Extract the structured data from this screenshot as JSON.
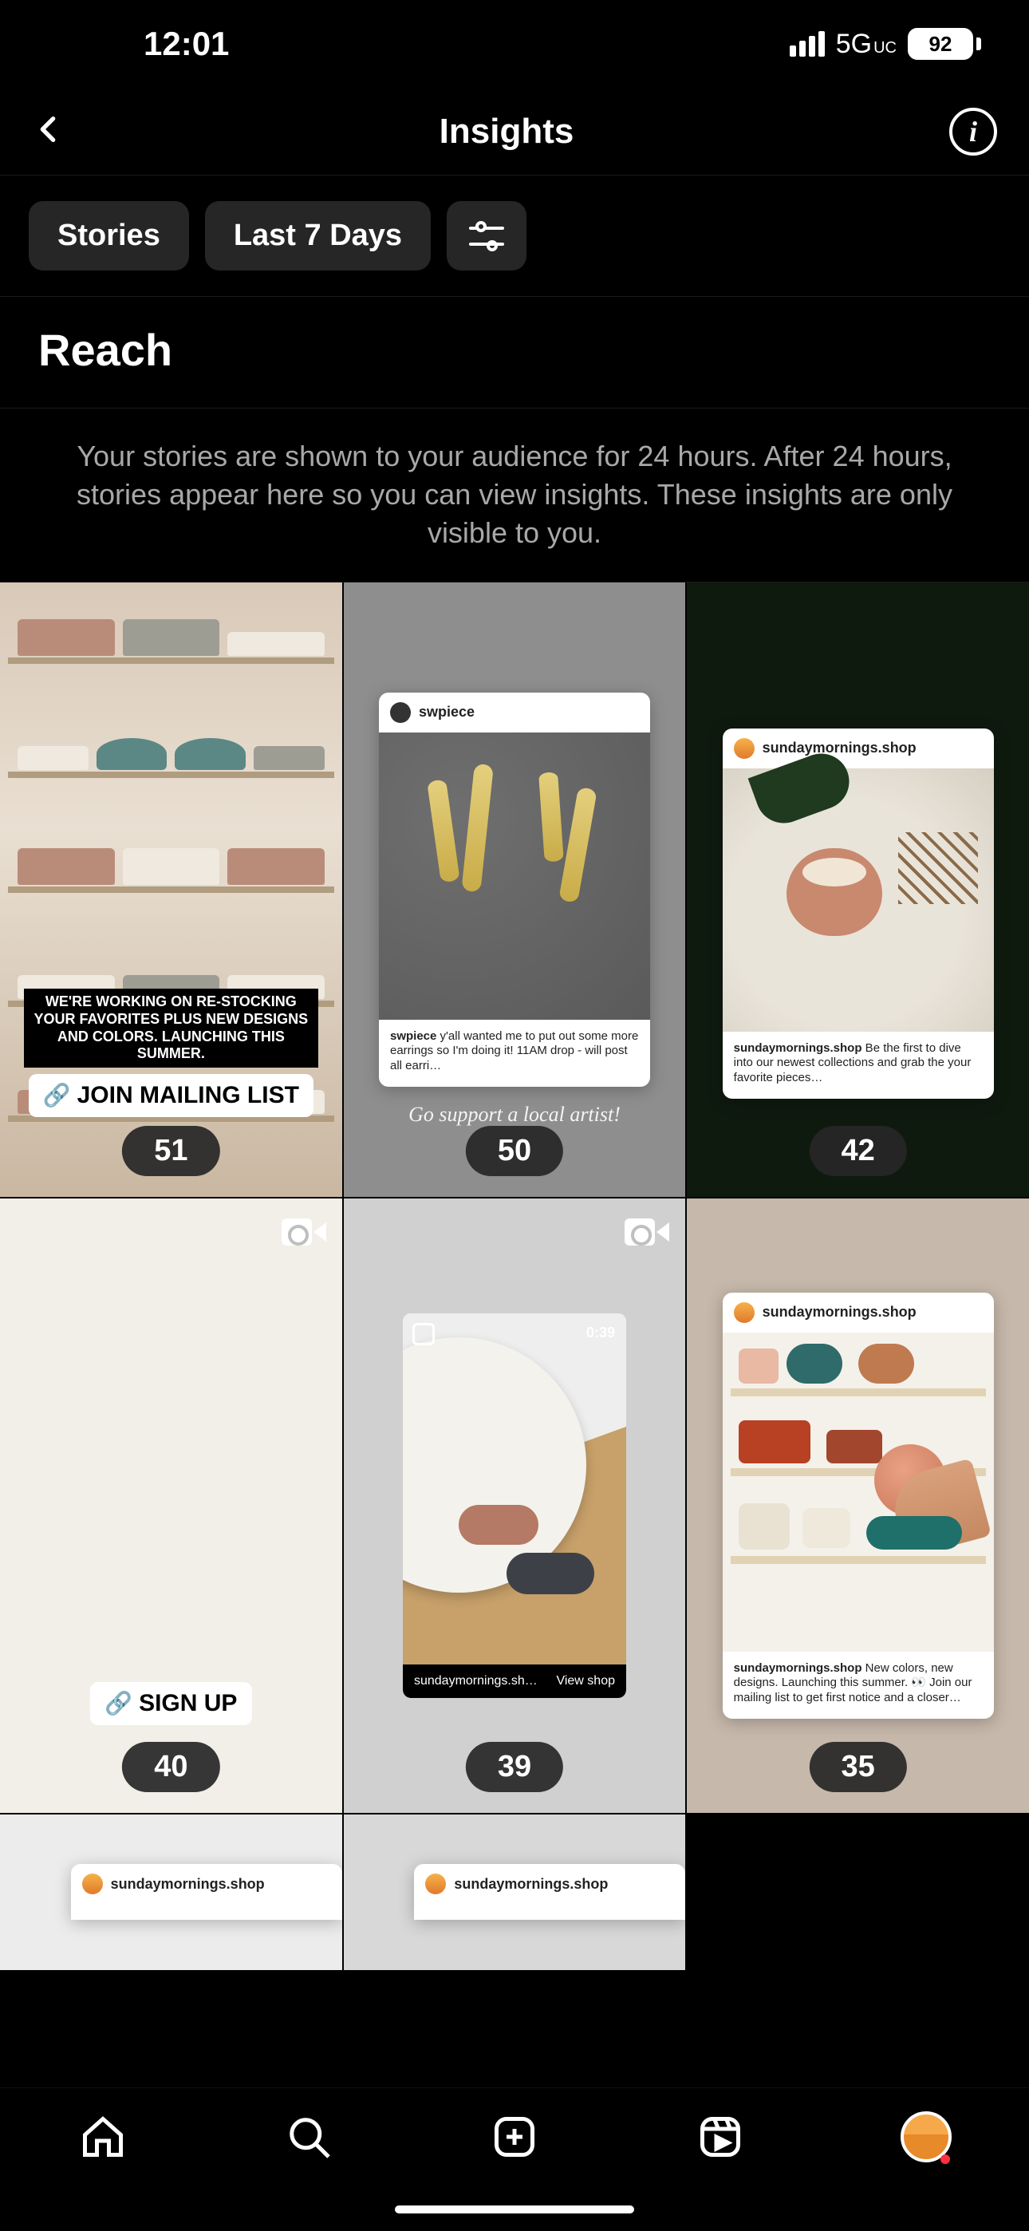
{
  "status": {
    "time": "12:01",
    "network": "5G",
    "network_sub": "UC",
    "battery": "92"
  },
  "header": {
    "title": "Insights"
  },
  "filters": {
    "content_type": "Stories",
    "period": "Last 7 Days"
  },
  "section": {
    "title": "Reach"
  },
  "description": "Your stories are shown to your audience for 24 hours. After 24 hours, stories appear here so you can view insights. These insights are only visible to you.",
  "tiles": [
    {
      "reach": "51",
      "overlay_text": "WE'RE WORKING ON RE-STOCKING YOUR FAVORITES PLUS NEW DESIGNS AND COLORS. LAUNCHING THIS SUMMER.",
      "link_label": "JOIN MAILING LIST"
    },
    {
      "reach": "50",
      "post_user": "swpiece",
      "post_caption_bold": "swpiece",
      "post_caption": " y'all wanted me to put out some more earrings so I'm doing it! 11AM drop - will post all earri…",
      "caption_below": "Go support a local artist!"
    },
    {
      "reach": "42",
      "post_user": "sundaymornings.shop",
      "post_caption_bold": "sundaymornings.shop",
      "post_caption": " Be the first to dive into our newest collections and grab the your favorite pieces…"
    },
    {
      "reach": "40",
      "link_label": "SIGN UP"
    },
    {
      "reach": "39",
      "duration": "0:39",
      "footer_user": "sundaymornings.sh…",
      "footer_action": "View shop"
    },
    {
      "reach": "35",
      "post_user": "sundaymornings.shop",
      "post_caption_bold": "sundaymornings.shop",
      "post_caption": " New colors, new designs. Launching this summer. 👀 Join our mailing list to get first notice and a closer…"
    },
    {
      "post_user": "sundaymornings.shop"
    },
    {
      "post_user": "sundaymornings.shop"
    }
  ]
}
